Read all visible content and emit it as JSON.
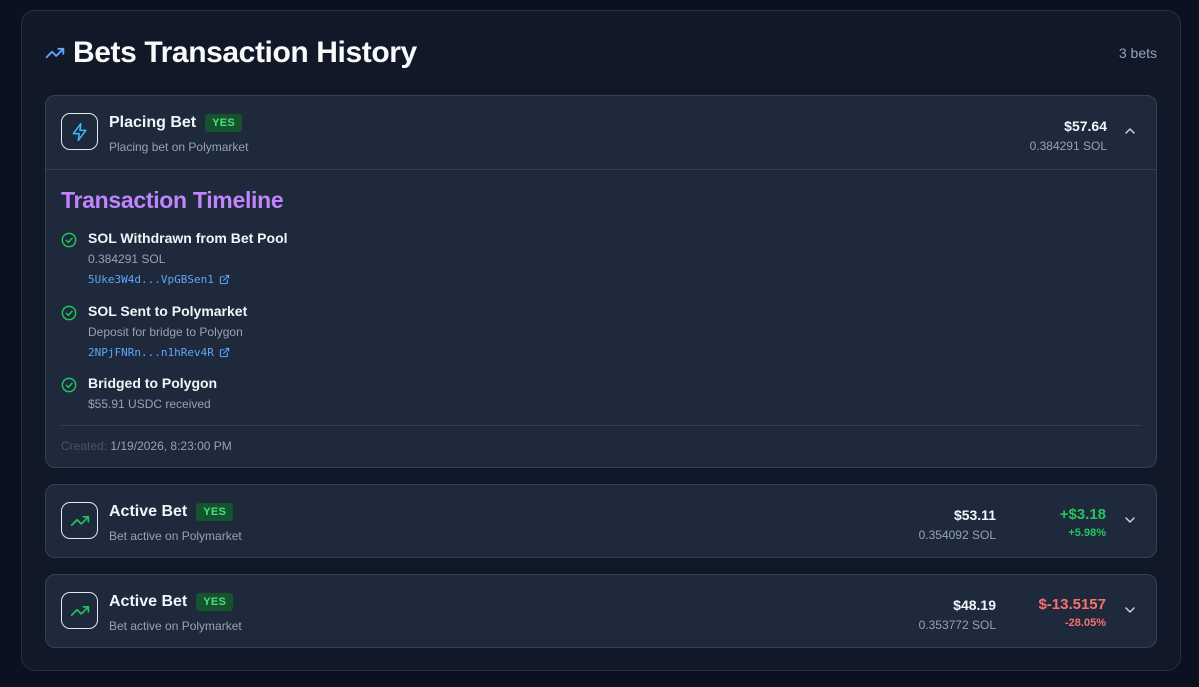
{
  "header": {
    "title": "Bets Transaction History",
    "count": "3 bets"
  },
  "bets": [
    {
      "title": "Placing Bet",
      "badge": "YES",
      "subtitle": "Placing bet on Polymarket",
      "usd": "$57.64",
      "sol": "0.384291 SOL",
      "icon": "lightning-icon",
      "expanded": true,
      "timeline": {
        "title": "Transaction Timeline",
        "steps": [
          {
            "title": "SOL Withdrawn from Bet Pool",
            "desc": "0.384291 SOL",
            "link": "5Uke3W4d...VpGBSen1"
          },
          {
            "title": "SOL Sent to Polymarket",
            "desc": "Deposit for bridge to Polygon",
            "link": "2NPjFNRn...n1hRev4R"
          },
          {
            "title": "Bridged to Polygon",
            "desc": "$55.91 USDC received"
          }
        ],
        "created_label": "Created:",
        "created_value": "1/19/2026, 8:23:00 PM"
      }
    },
    {
      "title": "Active Bet",
      "badge": "YES",
      "subtitle": "Bet active on Polymarket",
      "usd": "$53.11",
      "sol": "0.354092 SOL",
      "pnl": "+$3.18",
      "pnl_pct": "+5.98%",
      "icon": "trending-up-icon",
      "expanded": false
    },
    {
      "title": "Active Bet",
      "badge": "YES",
      "subtitle": "Bet active on Polymarket",
      "usd": "$48.19",
      "sol": "0.353772 SOL",
      "pnl": "$-13.5157",
      "pnl_pct": "-28.05%",
      "icon": "trending-up-icon",
      "expanded": false
    }
  ],
  "colors": {
    "accent_blue": "#60a5fa",
    "accent_purple": "#c084fc",
    "positive": "#22c55e",
    "negative": "#f87171",
    "badge_bg": "#14532d"
  }
}
